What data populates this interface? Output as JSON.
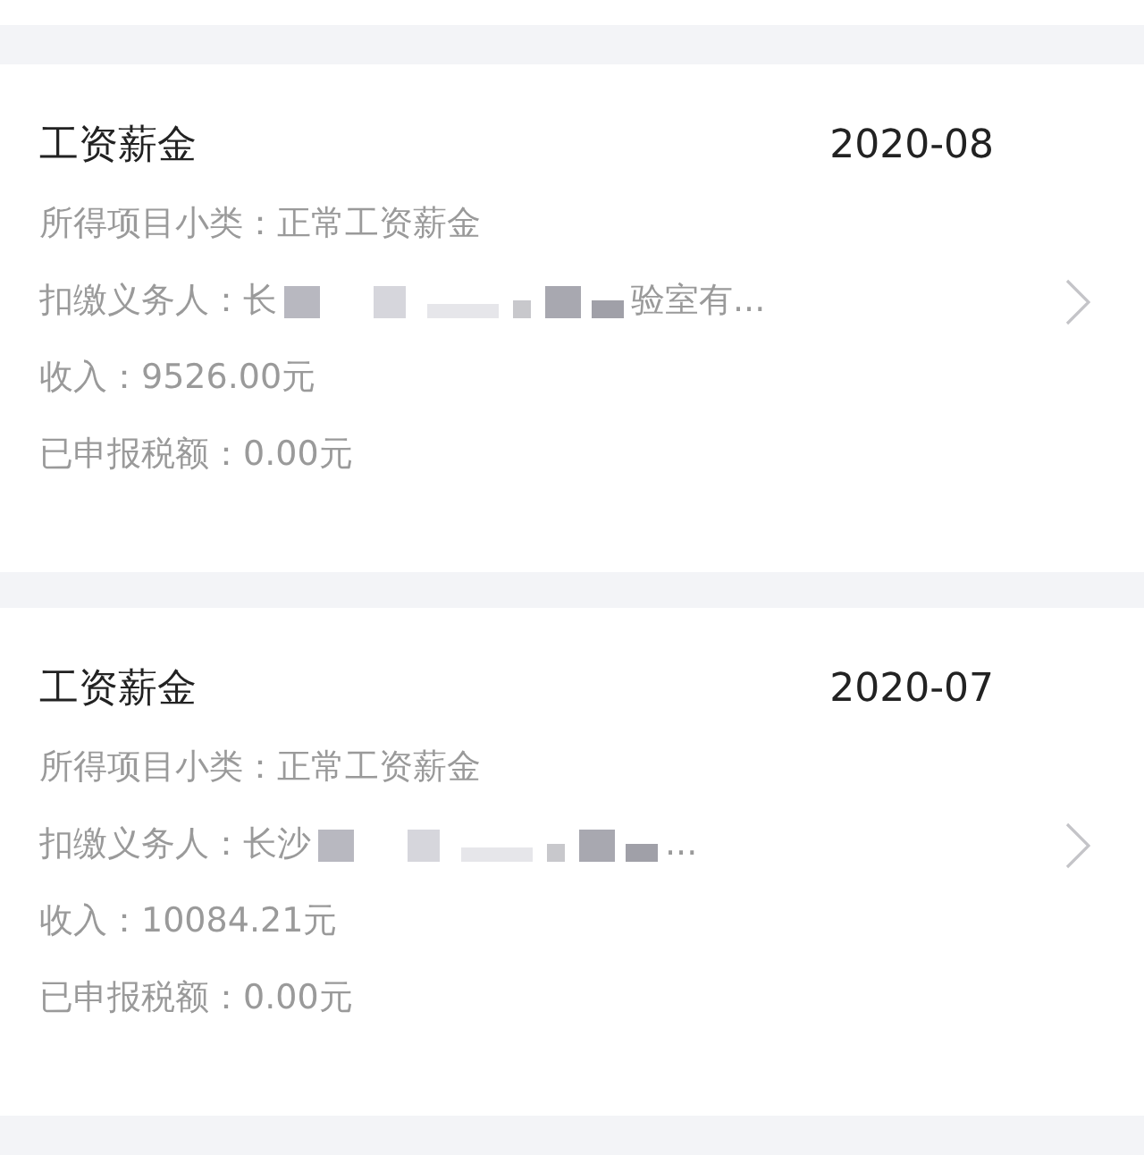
{
  "records": [
    {
      "title": "工资薪金",
      "period": "2020-08",
      "subcategory": "所得项目小类：正常工资薪金",
      "payer_prefix": "扣缴义务人：长",
      "payer_suffix": "验室有...",
      "income": "收入：9526.00元",
      "tax_declared": "已申报税额：0.00元"
    },
    {
      "title": "工资薪金",
      "period": "2020-07",
      "subcategory": "所得项目小类：正常工资薪金",
      "payer_prefix": "扣缴义务人：长沙",
      "payer_suffix": "...",
      "income": "收入：10084.21元",
      "tax_declared": "已申报税额：0.00元"
    }
  ]
}
